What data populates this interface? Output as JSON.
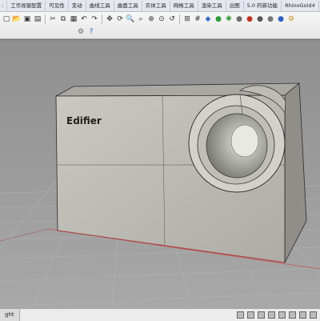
{
  "menu_tabs": [
    "工作视窗配置",
    "可见性",
    "变动",
    "曲线工具",
    "曲面工具",
    "实体工具",
    "网格工具",
    "渲染工具",
    "出图",
    "5.0 的新功能",
    "RhinoGold4"
  ],
  "toolbar_icons": [
    "new-file-icon",
    "open-icon",
    "save-icon",
    "print-icon",
    "cut-icon",
    "copy-icon",
    "paste-icon",
    "undo-icon",
    "redo-icon",
    "pan-icon",
    "rotate-view-icon",
    "zoom-icon",
    "zoom-window-icon",
    "zoom-extents-icon",
    "zoom-selected-icon",
    "undo-view-icon",
    "four-viewports-icon",
    "grid-icon",
    "layer-icon",
    "properties-icon",
    "osnap-icon",
    "shaded-sphere-icon",
    "render-sphere-icon",
    "material-icon",
    "light-icon",
    "lock-icon",
    "options-icon",
    "help-icon"
  ],
  "model": {
    "logo_text": "Edifier"
  },
  "status_bar": {
    "viewport_tab": "ght"
  }
}
